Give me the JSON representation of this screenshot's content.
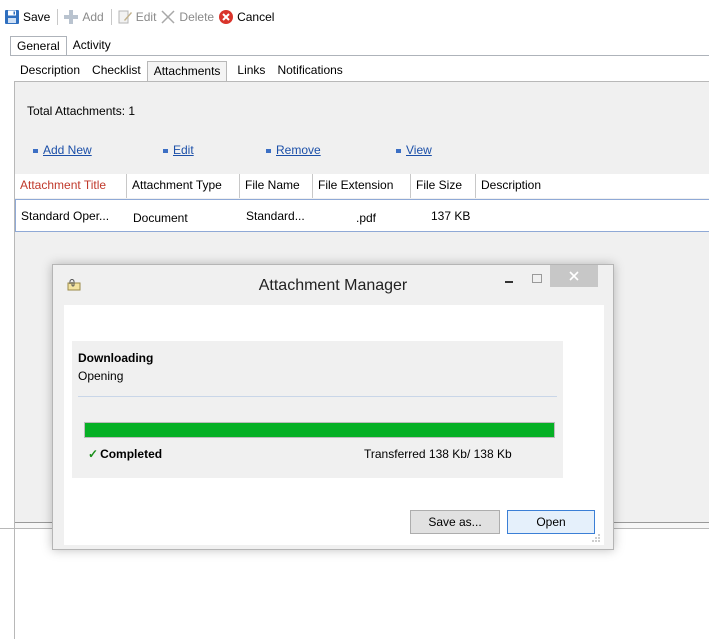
{
  "toolbar": {
    "save": "Save",
    "add": "Add",
    "edit": "Edit",
    "delete": "Delete",
    "cancel": "Cancel"
  },
  "tabs_main": [
    {
      "label": "General",
      "active": true
    },
    {
      "label": "Activity",
      "active": false
    }
  ],
  "tabs_sub": [
    {
      "label": "Description",
      "active": false
    },
    {
      "label": "Checklist",
      "active": false
    },
    {
      "label": "Attachments",
      "active": true
    },
    {
      "label": "Links",
      "active": false
    },
    {
      "label": "Notifications",
      "active": false
    }
  ],
  "attachments": {
    "total_label": "Total Attachments: 1",
    "actions": [
      "Add New",
      "Edit",
      "Remove",
      "View"
    ],
    "columns": [
      "Attachment Title",
      "Attachment Type",
      "File Name",
      "File Extension",
      "File Size",
      "Description"
    ],
    "rows": [
      {
        "title": "Standard Oper...",
        "type": "Document",
        "file_name": "Standard...",
        "extension": ".pdf",
        "size": "137 KB",
        "description": ""
      }
    ]
  },
  "dialog": {
    "title": "Attachment Manager",
    "heading": "Downloading",
    "status": "Opening",
    "progress_percent": 100,
    "completed": "Completed",
    "transferred": "Transferred  138 Kb/ 138 Kb",
    "save_as": "Save as...",
    "open": "Open"
  },
  "colors": {
    "progress": "#06b025",
    "sorted_header": "#c0392b",
    "link": "#1b4fa8"
  }
}
